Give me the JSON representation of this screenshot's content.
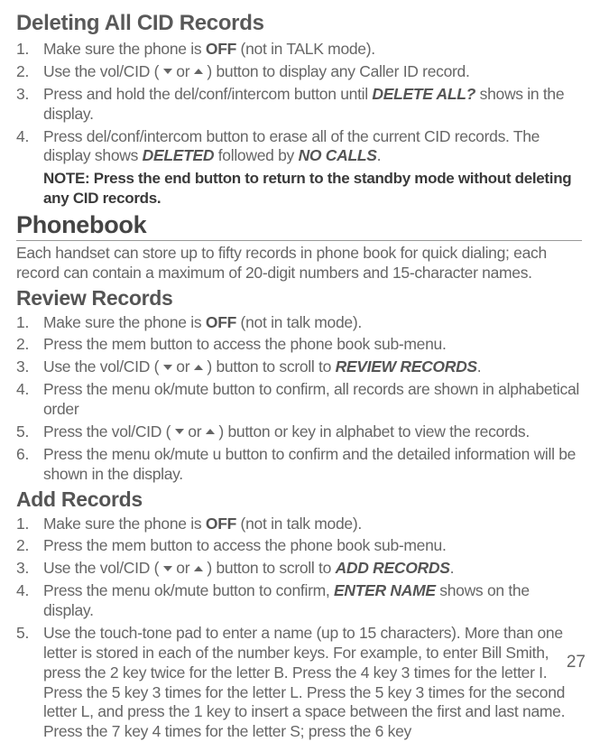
{
  "page_number": "27",
  "s1": {
    "title": "Deleting All CID Records",
    "items": [
      {
        "pre": "Make sure the phone is ",
        "b": "OFF",
        "post": " (not in TALK mode)."
      },
      {
        "pre": "Use the  vol/CID ( ",
        "mid": " or ",
        "post": " ) button to display any Caller ID record."
      },
      {
        "pre": "Press and hold the del/conf/intercom button until ",
        "bi": "DELETE ALL?",
        "post": " shows in the display."
      },
      {
        "pre": "Press del/conf/intercom button to erase all of the current CID records. The display shows ",
        "bi": "DELETED",
        "mid": " followed by ",
        "bi2": "NO CALLS",
        "post": "."
      }
    ],
    "note": "NOTE: Press the end button to return to the standby mode without deleting any CID records."
  },
  "s2": {
    "title": "Phonebook",
    "intro": "Each handset can store up to fifty records in phone book for quick dialing; each record can contain a maximum of 20-digit numbers and 15-character names."
  },
  "s3": {
    "title": "Review Records",
    "items": [
      {
        "pre": "Make sure the phone is ",
        "b": "OFF",
        "post": " (not in talk mode)."
      },
      {
        "pre": "Press the mem button to access the phone book sub-menu."
      },
      {
        "pre": "Use the vol/CID ( ",
        "mid": " or ",
        "post2": " )  button to scroll to ",
        "bi": "REVIEW RECORDS",
        "post": "."
      },
      {
        "pre": "Press the menu ok/mute  button to confirm, all records are shown in alphabetical order"
      },
      {
        "pre": "Press the vol/CID ( ",
        "mid": " or ",
        "post": " )  button or key in alphabet to view the records."
      },
      {
        "pre": "Press the menu ok/mute u button to confirm and the detailed information will be shown in the display."
      }
    ]
  },
  "s4": {
    "title": "Add Records",
    "items": [
      {
        "pre": "Make sure the phone is ",
        "b": "OFF",
        "post": " (not in talk mode)."
      },
      {
        "pre": "Press the mem button to access the phone book sub-menu."
      },
      {
        "pre": "Use the vol/CID ( ",
        "mid": " or ",
        "post2": " )  button to scroll to ",
        "bi": "ADD RECORDS",
        "post": "."
      },
      {
        "pre": "Press the menu ok/mute button to confirm, ",
        "bi": "ENTER NAME",
        "post": " shows on the display."
      },
      {
        "pre": "Use the touch-tone pad to enter a name (up to 15 characters). More than one letter is stored in each of the number keys. For example, to enter Bill Smith, press the 2 key twice for the letter B. Press the 4 key 3 times for the letter I. Press the 5 key 3 times for the letter L. Press the 5 key 3 times for the second letter L, and press the 1 key to insert a space between the first and last name. Press the 7 key 4 times for the letter S; press the 6 key"
      }
    ]
  }
}
